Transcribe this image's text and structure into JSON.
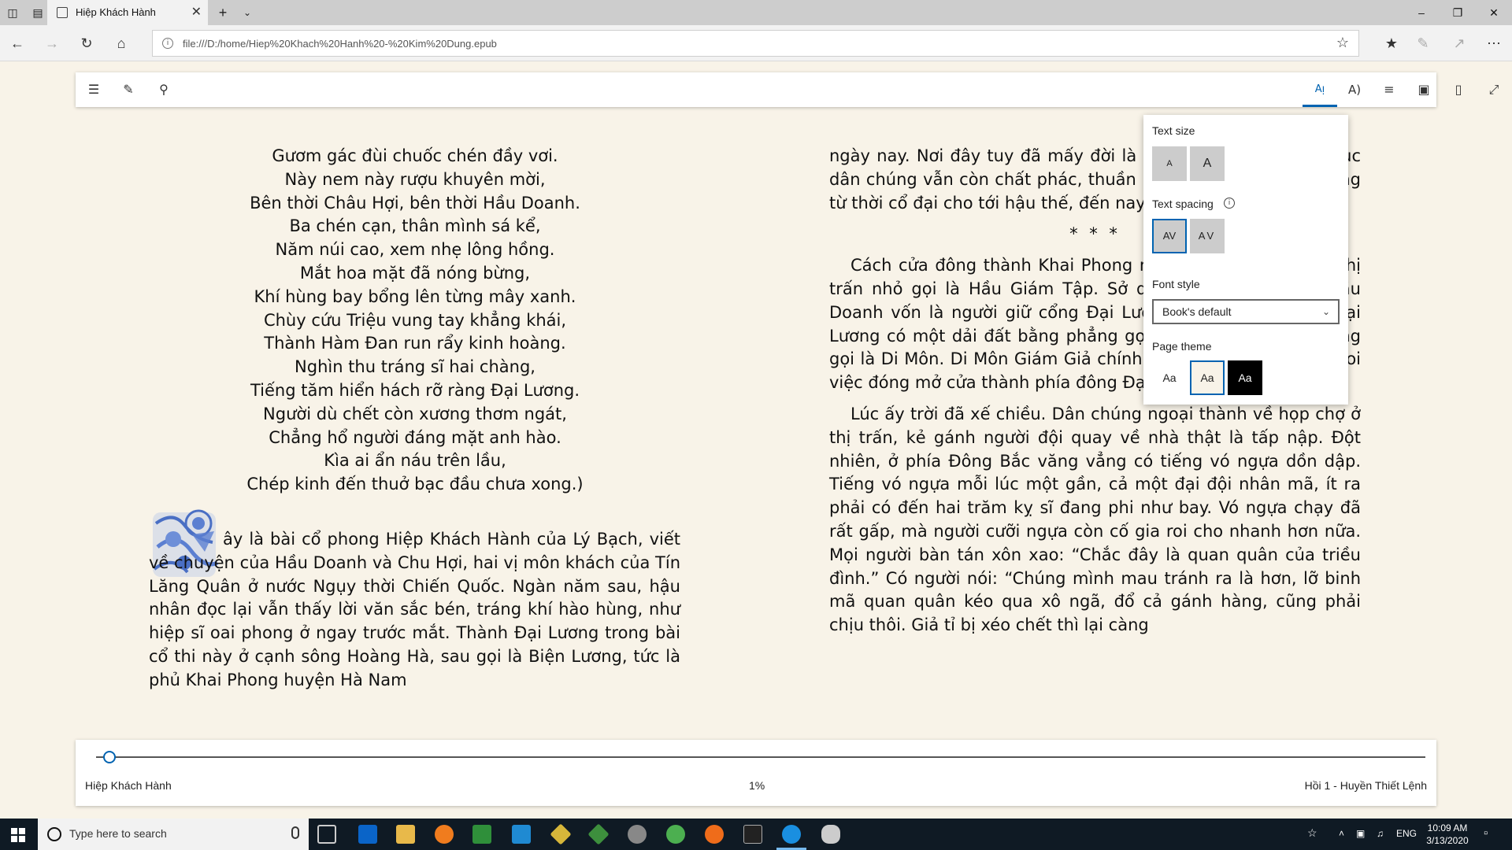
{
  "browser": {
    "tab_title": "Hiệp Khách Hành",
    "url": "file:///D:/home/Hiep%20Khach%20Hanh%20-%20Kim%20Dung.epub"
  },
  "reader_toolbar": {
    "left_icons": [
      "table-of-contents-icon",
      "notes-icon",
      "search-icon"
    ],
    "right_icons": [
      "text-options-icon",
      "read-aloud-icon",
      "learning-tools-icon",
      "save-icon",
      "bookmark-icon",
      "fullscreen-icon"
    ]
  },
  "left_page": {
    "poem": [
      "Gươm gác đùi chuốc chén đầy vơi.",
      "Này nem này rượu khuyên mời,",
      "Bên thời Châu Hợi, bên thời Hầu Doanh.",
      "Ba chén cạn, thân mình sá kể,",
      "Năm núi cao, xem nhẹ lông hồng.",
      "Mắt hoa mặt đã nóng bừng,",
      "Khí hùng bay bổng lên từng mây xanh.",
      "Chùy cứu Triệu vung tay khẳng khái,",
      "Thành Hàm Đan run rẩy kinh hoàng.",
      "Nghìn thu tráng sĩ hai chàng,",
      "Tiếng tăm hiển hách rỡ ràng Đại Lương.",
      "Người dù chết còn xương thơm ngát,",
      "Chẳng hổ người đáng mặt anh hào.",
      "Kìa ai ẩn náu trên lầu,",
      "Chép kinh đến thuở bạc đầu chưa xong.)"
    ],
    "paragraph": "ây là bài cổ phong Hiệp Khách Hành của Lý Bạch, viết về chuyện của Hầu Doanh và Chu Hợi, hai vị môn khách của Tín Lăng Quân ở nước Ngụy thời Chiến Quốc. Ngàn năm sau, hậu nhân đọc lại vẫn thấy lời văn sắc bén, tráng khí hào hùng, như hiệp sĩ oai phong ở ngay trước mắt. Thành Đại Lương trong bài cổ thi này ở cạnh sông Hoàng Hà, sau gọi là Biện Lương, tức là phủ Khai Phong huyện Hà Nam"
  },
  "right_page": {
    "para1": "ngày nay. Nơi đây tuy đã mấy đời là kinh đô, nhưng phong tục dân chúng vẫn còn chất phác, thuần hậu, khẳng khái anh hùng từ thời cổ đại cho tới hậu thế, đến nay vẫn chưa mai một.",
    "separator": "* * *",
    "para2": "Cách cửa đông thành Khai Phong mười mấy dặm có một thị trấn nhỏ gọi là Hầu Giám Tập. Sở dĩ có tên như thế, vì Hầu Doanh vốn là người giữ cổng Đại Lương. Phía đông thành Đại Lương có một dải đất bằng phẳng gọi là Di Sơn, nên cửa đông gọi là Di Môn. Di Môn Giám Giả chính là một chức quan nhỏ coi việc đóng mở cửa thành phía đông Đại Lương.",
    "para3": "Lúc ấy trời đã xế chiều. Dân chúng ngoại thành về họp chợ ở thị trấn, kẻ gánh người đội quay về nhà thật là tấp nập. Đột nhiên, ở phía Đông Bắc văng vẳng có tiếng vó ngựa dồn dập. Tiếng vó ngựa mỗi lúc một gần, cả một đại đội nhân mã, ít ra phải có đến hai trăm kỵ sĩ đang phi như bay. Vó ngựa chạy đã rất gấp, mà người cưỡi ngựa còn cố gia roi cho nhanh hơn nữa. Mọi người bàn tán xôn xao: “Chắc đây là quan quân của triều đình.” Có người nói: “Chúng mình mau tránh ra là hơn, lỡ binh mã quan quân kéo qua xô ngã, đổ cả gánh hàng, cũng phải chịu thôi. Giả tỉ bị xéo chết thì lại càng"
  },
  "text_panel": {
    "text_size_label": "Text size",
    "size_small": "A",
    "size_large": "A",
    "text_spacing_label": "Text spacing",
    "spacing_narrow": "AV",
    "spacing_wide": "AV",
    "font_style_label": "Font style",
    "font_value": "Book's default",
    "page_theme_label": "Page theme",
    "theme_light": "Aa",
    "theme_sepia": "Aa",
    "theme_dark": "Aa"
  },
  "bottom_bar": {
    "book_title": "Hiệp Khách Hành",
    "progress_text": "1%",
    "progress": 0.01,
    "chapter": "Hồi 1 - Huyền Thiết Lệnh"
  },
  "taskbar": {
    "search_placeholder": "Type here to search",
    "language": "ENG",
    "time": "10:09 AM",
    "date": "3/13/2020"
  },
  "colors": {
    "accent": "#0063b1",
    "page_background": "#f8f3e8",
    "taskbar": "#0f1a24"
  }
}
